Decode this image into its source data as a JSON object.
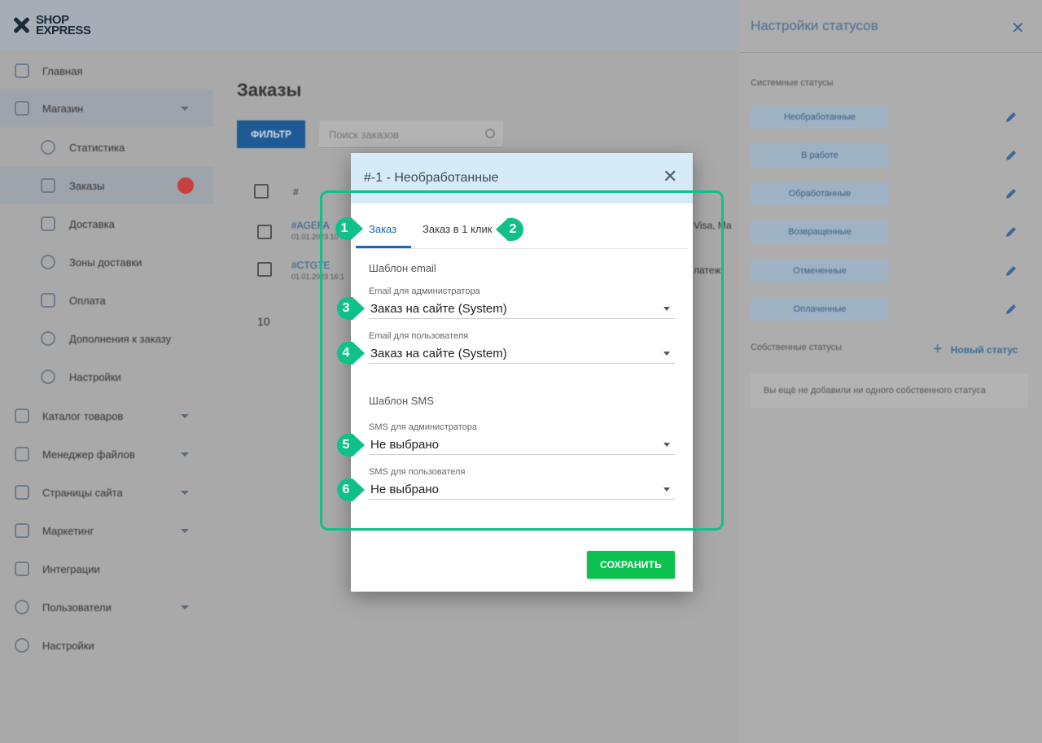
{
  "logo": {
    "line1": "SHOP",
    "line2": "EXPRESS"
  },
  "sidebar": {
    "items": [
      {
        "label": "Главная"
      },
      {
        "label": "Магазин"
      },
      {
        "label": "Статистика"
      },
      {
        "label": "Заказы"
      },
      {
        "label": "Доставка"
      },
      {
        "label": "Зоны доставки"
      },
      {
        "label": "Оплата"
      },
      {
        "label": "Дополнения к заказу"
      },
      {
        "label": "Настройки"
      },
      {
        "label": "Каталог товаров"
      },
      {
        "label": "Менеджер файлов"
      },
      {
        "label": "Страницы сайта"
      },
      {
        "label": "Маркетинг"
      },
      {
        "label": "Интеграции"
      },
      {
        "label": "Пользователи"
      },
      {
        "label": "Настройки"
      }
    ]
  },
  "main": {
    "title": "Заказы",
    "filter_label": "ФИЛЬТР",
    "search_placeholder": "Поиск заказов",
    "table": {
      "header_number": "#",
      "rows": [
        {
          "id": "#AGEFA",
          "date": "01.01.2023 10",
          "tail": "Visa, Ма"
        },
        {
          "id": "#CTGTE",
          "date": "01.01.2023 16:1",
          "tail": "латеж"
        }
      ]
    },
    "page_size": "10"
  },
  "status_panel": {
    "title": "Настройки статусов",
    "system_label": "Системные статусы",
    "system_statuses": [
      "Необработанные",
      "В работе",
      "Обработанные",
      "Возвращенные",
      "Отмененные",
      "Оплаченные"
    ],
    "custom_label": "Собственные статусы",
    "new_status_label": "Новый статус",
    "empty_text": "Вы ещё не добавили ни одного собственного статуса"
  },
  "modal": {
    "title": "#-1 - Необработанные",
    "tabs": [
      {
        "label": "Заказ",
        "active": true
      },
      {
        "label": "Заказ в 1 клик",
        "active": false
      }
    ],
    "email_section": "Шаблон email",
    "sms_section": "Шаблон SMS",
    "fields": [
      {
        "label": "Email для администратора",
        "value": "Заказ на сайте (System)"
      },
      {
        "label": "Email для пользователя",
        "value": "Заказ на сайте (System)"
      },
      {
        "label": "SMS для администратора",
        "value": "Не выбрано"
      },
      {
        "label": "SMS для пользователя",
        "value": "Не выбрано"
      }
    ],
    "save_label": "СОХРАНИТЬ"
  },
  "annotations": {
    "color": "#10c08a",
    "markers": [
      "1",
      "2",
      "3",
      "4",
      "5",
      "6"
    ]
  }
}
